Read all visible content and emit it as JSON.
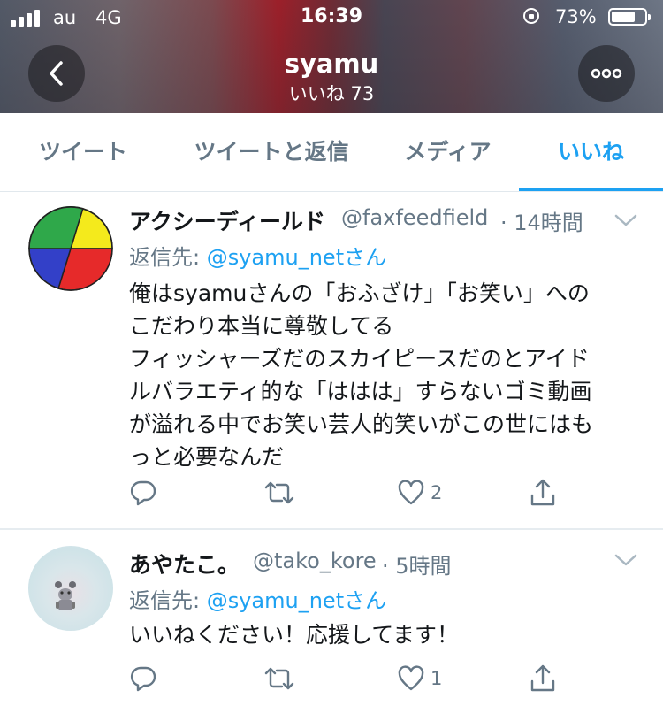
{
  "status_bar": {
    "carrier": "au",
    "network": "4G",
    "time": "16:39",
    "battery_percent": "73%",
    "battery_level": 0.73,
    "signal_bars": 4
  },
  "header": {
    "title": "syamu",
    "subtitle": "いいね 73",
    "back_icon": "chevron-left-icon",
    "more_icon": "ellipsis-icon"
  },
  "tabs": [
    {
      "label": "ツイート",
      "active": false
    },
    {
      "label": "ツイートと返信",
      "active": false
    },
    {
      "label": "メディア",
      "active": false
    },
    {
      "label": "いいね",
      "active": true
    }
  ],
  "colors": {
    "accent": "#1da1f2",
    "text": "#14171a",
    "secondary": "#657786"
  },
  "tweets": [
    {
      "display_name": "アクシーディールド",
      "handle": "@faxfeedfield",
      "time": "· 14時間",
      "reply_prefix": "返信先: ",
      "reply_mention": "@syamu_netさん",
      "text_lines": [
        "俺はsyamuさんの「おふざけ」「お笑い」への",
        "こだわり本当に尊敬してる",
        "フィッシャーズだのスカイピースだのとアイド",
        "ルバラエティ的な「ははは」すらないゴミ動画",
        "が溢れる中でお笑い芸人的笑いがこの世にはも",
        "っと必要なんだ"
      ],
      "replies": "",
      "retweets": "",
      "likes": "2"
    },
    {
      "display_name": "あやたこ。",
      "handle": "@tako_kore",
      "time": "· 5時間",
      "reply_prefix": "返信先: ",
      "reply_mention": "@syamu_netさん",
      "text_lines": [
        "いいねください！応援してます！"
      ],
      "replies": "",
      "retweets": "",
      "likes": "1"
    }
  ]
}
